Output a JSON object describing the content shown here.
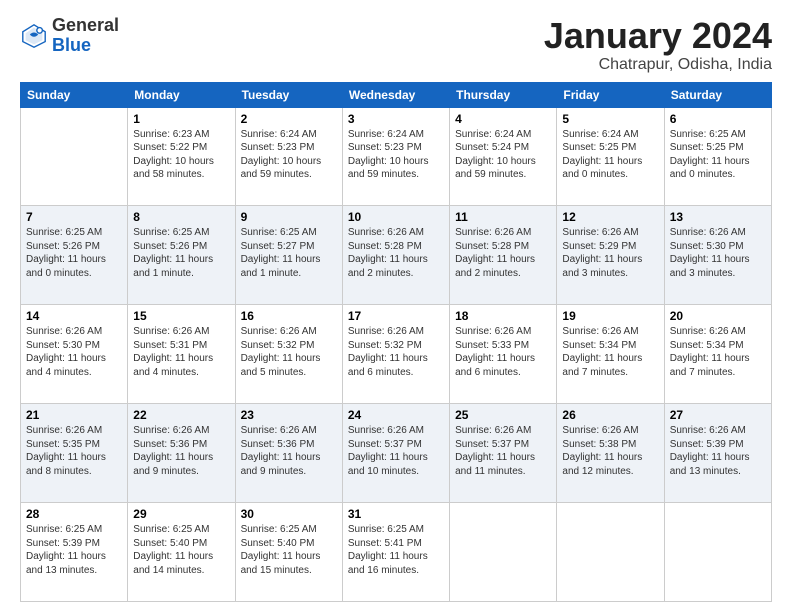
{
  "header": {
    "logo_general": "General",
    "logo_blue": "Blue",
    "month_title": "January 2024",
    "location": "Chatrapur, Odisha, India"
  },
  "days_of_week": [
    "Sunday",
    "Monday",
    "Tuesday",
    "Wednesday",
    "Thursday",
    "Friday",
    "Saturday"
  ],
  "weeks": [
    [
      {
        "day": "",
        "info": ""
      },
      {
        "day": "1",
        "info": "Sunrise: 6:23 AM\nSunset: 5:22 PM\nDaylight: 10 hours\nand 58 minutes."
      },
      {
        "day": "2",
        "info": "Sunrise: 6:24 AM\nSunset: 5:23 PM\nDaylight: 10 hours\nand 59 minutes."
      },
      {
        "day": "3",
        "info": "Sunrise: 6:24 AM\nSunset: 5:23 PM\nDaylight: 10 hours\nand 59 minutes."
      },
      {
        "day": "4",
        "info": "Sunrise: 6:24 AM\nSunset: 5:24 PM\nDaylight: 10 hours\nand 59 minutes."
      },
      {
        "day": "5",
        "info": "Sunrise: 6:24 AM\nSunset: 5:25 PM\nDaylight: 11 hours\nand 0 minutes."
      },
      {
        "day": "6",
        "info": "Sunrise: 6:25 AM\nSunset: 5:25 PM\nDaylight: 11 hours\nand 0 minutes."
      }
    ],
    [
      {
        "day": "7",
        "info": "Sunrise: 6:25 AM\nSunset: 5:26 PM\nDaylight: 11 hours\nand 0 minutes."
      },
      {
        "day": "8",
        "info": "Sunrise: 6:25 AM\nSunset: 5:26 PM\nDaylight: 11 hours\nand 1 minute."
      },
      {
        "day": "9",
        "info": "Sunrise: 6:25 AM\nSunset: 5:27 PM\nDaylight: 11 hours\nand 1 minute."
      },
      {
        "day": "10",
        "info": "Sunrise: 6:26 AM\nSunset: 5:28 PM\nDaylight: 11 hours\nand 2 minutes."
      },
      {
        "day": "11",
        "info": "Sunrise: 6:26 AM\nSunset: 5:28 PM\nDaylight: 11 hours\nand 2 minutes."
      },
      {
        "day": "12",
        "info": "Sunrise: 6:26 AM\nSunset: 5:29 PM\nDaylight: 11 hours\nand 3 minutes."
      },
      {
        "day": "13",
        "info": "Sunrise: 6:26 AM\nSunset: 5:30 PM\nDaylight: 11 hours\nand 3 minutes."
      }
    ],
    [
      {
        "day": "14",
        "info": "Sunrise: 6:26 AM\nSunset: 5:30 PM\nDaylight: 11 hours\nand 4 minutes."
      },
      {
        "day": "15",
        "info": "Sunrise: 6:26 AM\nSunset: 5:31 PM\nDaylight: 11 hours\nand 4 minutes."
      },
      {
        "day": "16",
        "info": "Sunrise: 6:26 AM\nSunset: 5:32 PM\nDaylight: 11 hours\nand 5 minutes."
      },
      {
        "day": "17",
        "info": "Sunrise: 6:26 AM\nSunset: 5:32 PM\nDaylight: 11 hours\nand 6 minutes."
      },
      {
        "day": "18",
        "info": "Sunrise: 6:26 AM\nSunset: 5:33 PM\nDaylight: 11 hours\nand 6 minutes."
      },
      {
        "day": "19",
        "info": "Sunrise: 6:26 AM\nSunset: 5:34 PM\nDaylight: 11 hours\nand 7 minutes."
      },
      {
        "day": "20",
        "info": "Sunrise: 6:26 AM\nSunset: 5:34 PM\nDaylight: 11 hours\nand 7 minutes."
      }
    ],
    [
      {
        "day": "21",
        "info": "Sunrise: 6:26 AM\nSunset: 5:35 PM\nDaylight: 11 hours\nand 8 minutes."
      },
      {
        "day": "22",
        "info": "Sunrise: 6:26 AM\nSunset: 5:36 PM\nDaylight: 11 hours\nand 9 minutes."
      },
      {
        "day": "23",
        "info": "Sunrise: 6:26 AM\nSunset: 5:36 PM\nDaylight: 11 hours\nand 9 minutes."
      },
      {
        "day": "24",
        "info": "Sunrise: 6:26 AM\nSunset: 5:37 PM\nDaylight: 11 hours\nand 10 minutes."
      },
      {
        "day": "25",
        "info": "Sunrise: 6:26 AM\nSunset: 5:37 PM\nDaylight: 11 hours\nand 11 minutes."
      },
      {
        "day": "26",
        "info": "Sunrise: 6:26 AM\nSunset: 5:38 PM\nDaylight: 11 hours\nand 12 minutes."
      },
      {
        "day": "27",
        "info": "Sunrise: 6:26 AM\nSunset: 5:39 PM\nDaylight: 11 hours\nand 13 minutes."
      }
    ],
    [
      {
        "day": "28",
        "info": "Sunrise: 6:25 AM\nSunset: 5:39 PM\nDaylight: 11 hours\nand 13 minutes."
      },
      {
        "day": "29",
        "info": "Sunrise: 6:25 AM\nSunset: 5:40 PM\nDaylight: 11 hours\nand 14 minutes."
      },
      {
        "day": "30",
        "info": "Sunrise: 6:25 AM\nSunset: 5:40 PM\nDaylight: 11 hours\nand 15 minutes."
      },
      {
        "day": "31",
        "info": "Sunrise: 6:25 AM\nSunset: 5:41 PM\nDaylight: 11 hours\nand 16 minutes."
      },
      {
        "day": "",
        "info": ""
      },
      {
        "day": "",
        "info": ""
      },
      {
        "day": "",
        "info": ""
      }
    ]
  ]
}
